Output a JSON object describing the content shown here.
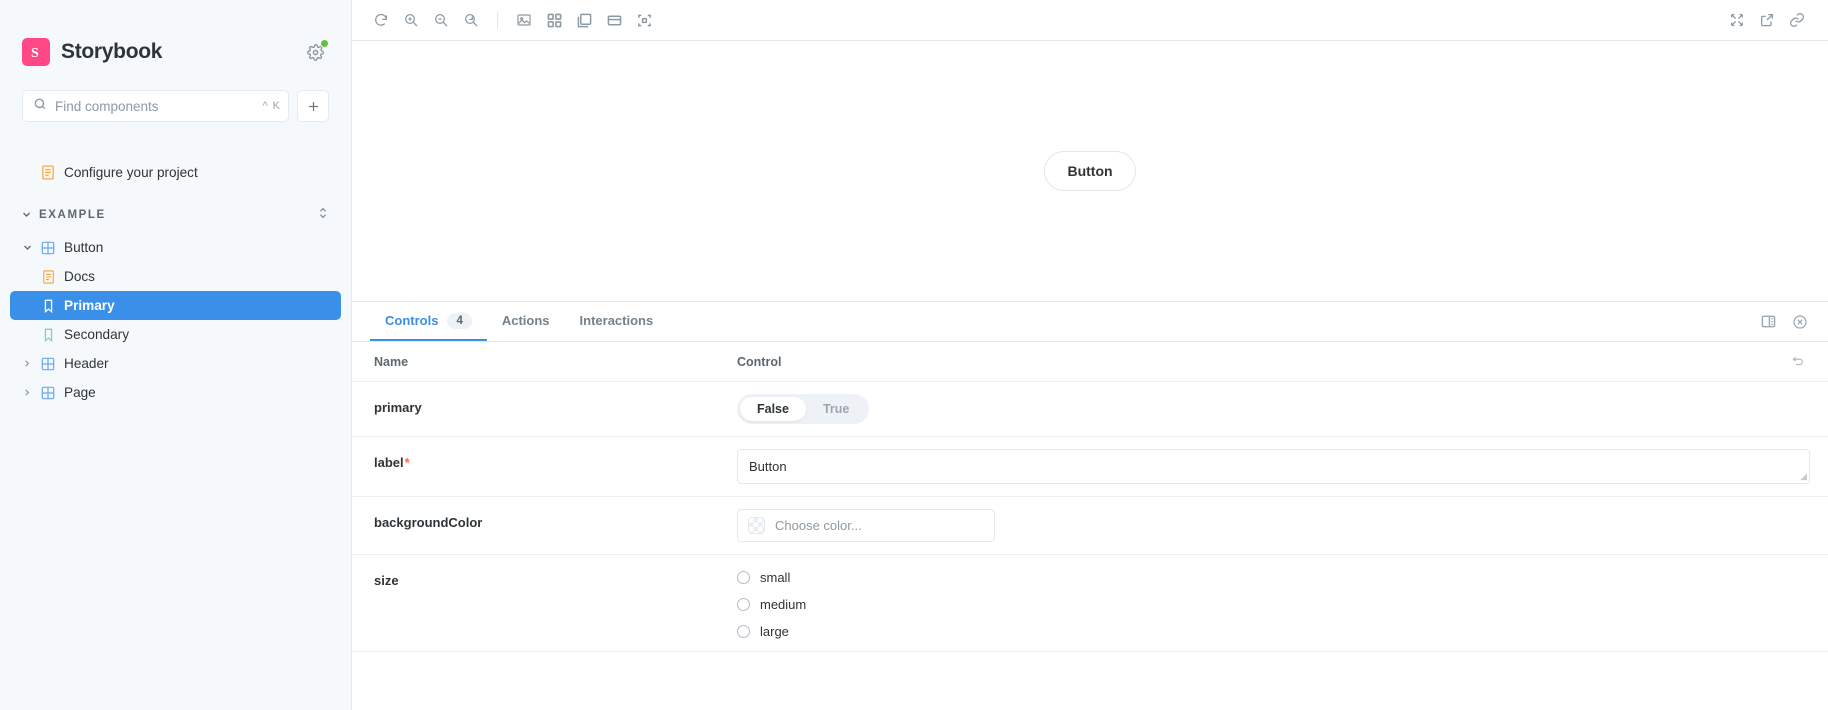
{
  "sidebar": {
    "brand": {
      "name": "Storybook",
      "logo_letter": "S",
      "logo_color": "#ff4785"
    },
    "shortcut_icon": "shortcuts-gear-icon",
    "status_dot_color": "#66bf3c",
    "search": {
      "placeholder": "Find components",
      "value": "",
      "kbd_primary": "^",
      "kbd_secondary": "K"
    },
    "add_label": "+",
    "items": [
      {
        "label": "Configure your project",
        "icon": "document-icon",
        "level": 0,
        "kind": "doc",
        "selected": false,
        "chevron": ""
      },
      {
        "label": "EXAMPLE",
        "icon": "",
        "level": 0,
        "kind": "group",
        "selected": false,
        "chevron": "∨"
      },
      {
        "label": "Button",
        "icon": "component-icon",
        "level": 0,
        "kind": "component",
        "selected": false,
        "chevron": "∨"
      },
      {
        "label": "Docs",
        "icon": "document-icon",
        "level": 1,
        "kind": "doc",
        "selected": false,
        "chevron": ""
      },
      {
        "label": "Primary",
        "icon": "story-bookmark-icon",
        "level": 1,
        "kind": "story",
        "selected": true,
        "chevron": ""
      },
      {
        "label": "Secondary",
        "icon": "story-bookmark-icon",
        "level": 1,
        "kind": "story",
        "selected": false,
        "chevron": ""
      },
      {
        "label": "Header",
        "icon": "component-icon",
        "level": 0,
        "kind": "component",
        "selected": false,
        "chevron": "›"
      },
      {
        "label": "Page",
        "icon": "component-icon",
        "level": 0,
        "kind": "component",
        "selected": false,
        "chevron": "›"
      }
    ]
  },
  "toolbar": {
    "left_icons": [
      "remount-icon",
      "zoom-in-icon",
      "zoom-out-icon",
      "zoom-reset-icon"
    ],
    "view_icons": [
      "background-image-icon",
      "grid-icon",
      "measure-icon",
      "viewport-icon",
      "outline-icon"
    ],
    "right_icons": [
      "fullscreen-icon",
      "open-new-tab-icon",
      "copy-link-icon"
    ]
  },
  "preview": {
    "button_label": "Button"
  },
  "panel": {
    "tabs": [
      {
        "label": "Controls",
        "badge": "4",
        "active": true
      },
      {
        "label": "Actions",
        "badge": "",
        "active": false
      },
      {
        "label": "Interactions",
        "badge": "",
        "active": false
      }
    ],
    "right_icons": [
      "panel-position-icon",
      "close-panel-icon"
    ],
    "columns": {
      "name": "Name",
      "control": "Control"
    },
    "reset_icon": "reset-arrow-icon",
    "rows": [
      {
        "name": "primary",
        "required": false,
        "type": "boolean",
        "options": [
          {
            "label": "False",
            "selected": true
          },
          {
            "label": "True",
            "selected": false
          }
        ]
      },
      {
        "name": "label",
        "required": true,
        "required_mark": "*",
        "type": "text",
        "value": "Button"
      },
      {
        "name": "backgroundColor",
        "required": false,
        "type": "color",
        "placeholder": "Choose color..."
      },
      {
        "name": "size",
        "required": false,
        "type": "radio",
        "options": [
          {
            "label": "small",
            "selected": false
          },
          {
            "label": "medium",
            "selected": false
          },
          {
            "label": "large",
            "selected": false
          }
        ]
      }
    ]
  },
  "colors": {
    "accent": "#3a8fe8",
    "brand": "#ff4785",
    "required": "#ff6b4a",
    "status": "#66bf3c"
  }
}
